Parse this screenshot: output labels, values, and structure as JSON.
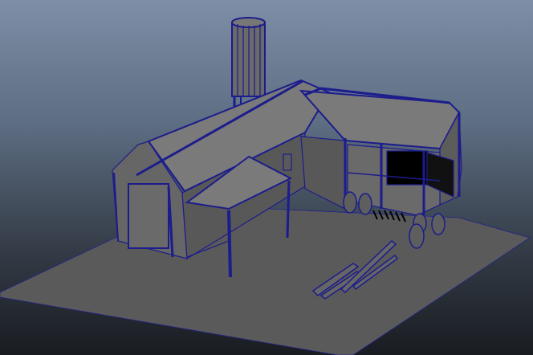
{
  "viewport": {
    "colors": {
      "wire": "#1c1c8c",
      "surface": "#6e6e6e",
      "surface_light": "#828282",
      "surface_dark": "#555555",
      "ground": "#5a5a5a"
    }
  }
}
